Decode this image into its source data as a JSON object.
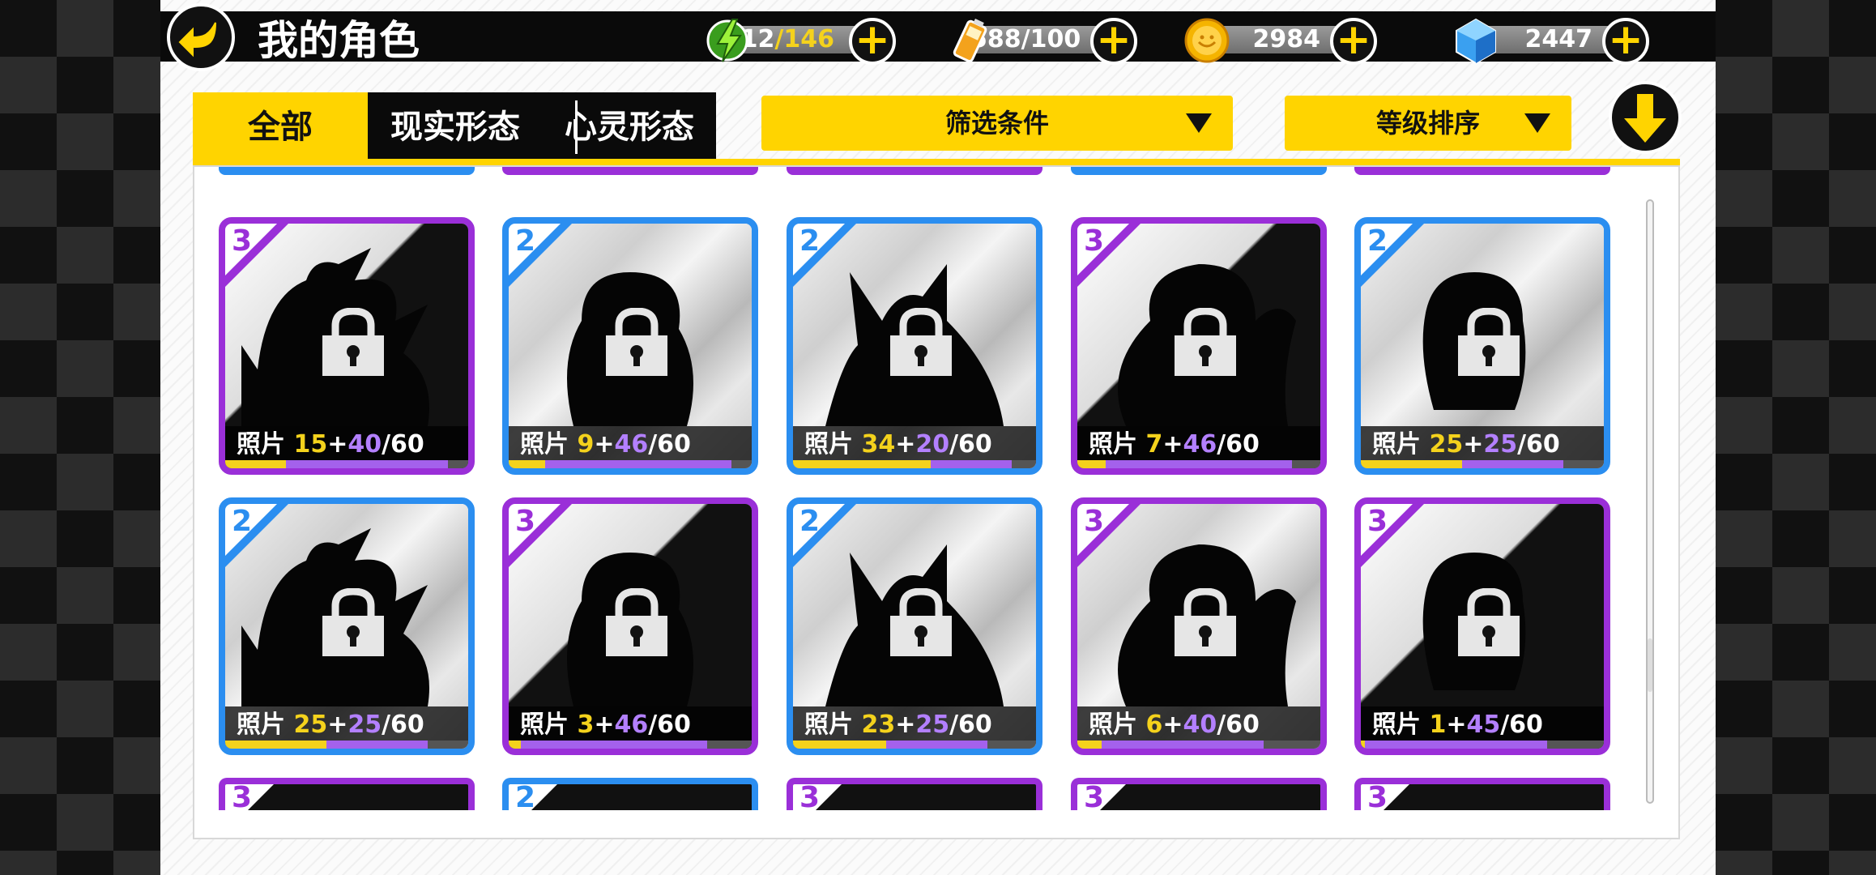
{
  "header": {
    "title": "我的角色"
  },
  "resources": {
    "energy": {
      "current": "12",
      "max": "/146",
      "icon": "lightning-icon"
    },
    "battery": {
      "value": "588/100",
      "icon": "battery-icon"
    },
    "coins": {
      "value": "2984",
      "icon": "coin-icon"
    },
    "gems": {
      "value": "2447",
      "icon": "gem-icon"
    }
  },
  "tabs": [
    {
      "label": "全部",
      "active": true
    },
    {
      "label": "现实形态",
      "active": false
    },
    {
      "label": "心灵形态",
      "active": false
    }
  ],
  "filters": {
    "filter_label": "筛选条件",
    "sort_label": "等级排序"
  },
  "card_label": "照片",
  "cards": [
    {
      "rarity": "3",
      "a": "15",
      "b": "40",
      "total": "/60",
      "locked": true
    },
    {
      "rarity": "2",
      "a": "9",
      "b": "46",
      "total": "/60",
      "locked": true
    },
    {
      "rarity": "2",
      "a": "34",
      "b": "20",
      "total": "/60",
      "locked": true
    },
    {
      "rarity": "3",
      "a": "7",
      "b": "46",
      "total": "/60",
      "locked": true
    },
    {
      "rarity": "2",
      "a": "25",
      "b": "25",
      "total": "/60",
      "locked": true
    },
    {
      "rarity": "2",
      "a": "25",
      "b": "25",
      "total": "/60",
      "locked": true
    },
    {
      "rarity": "3",
      "a": "3",
      "b": "46",
      "total": "/60",
      "locked": true
    },
    {
      "rarity": "2",
      "a": "23",
      "b": "25",
      "total": "/60",
      "locked": true
    },
    {
      "rarity": "3",
      "a": "6",
      "b": "40",
      "total": "/60",
      "locked": true
    },
    {
      "rarity": "3",
      "a": "1",
      "b": "45",
      "total": "/60",
      "locked": true
    }
  ],
  "next_row_rarities": [
    "3",
    "2",
    "3",
    "3",
    "3"
  ],
  "prev_row_rarities": [
    "2",
    "3",
    "3",
    "2",
    "3"
  ],
  "colors": {
    "accent": "#ffd400",
    "rarity2": "#2b8ef0",
    "rarity3": "#9a2fd8",
    "photo_owned": "#f4d21c",
    "photo_pending": "#b380ff"
  }
}
